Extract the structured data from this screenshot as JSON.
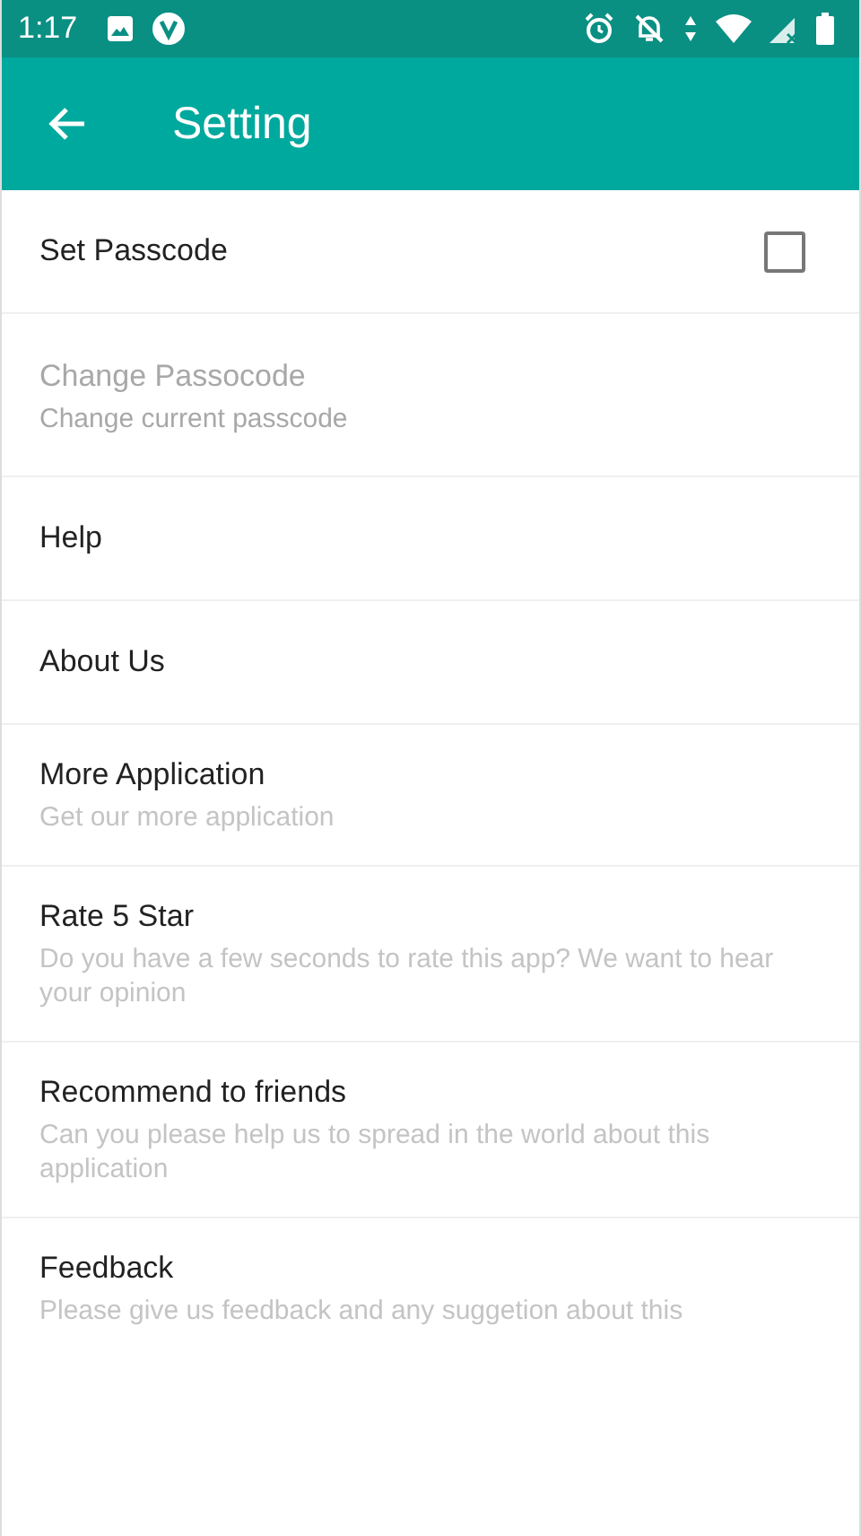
{
  "status_bar": {
    "time": "1:17"
  },
  "app_bar": {
    "title": "Setting"
  },
  "items": [
    {
      "kind": "checkbox",
      "title": "Set Passcode",
      "checked": false,
      "disabled": false
    },
    {
      "kind": "text",
      "title": "Change Passocode",
      "subtitle": "Change current passcode",
      "disabled": true
    },
    {
      "kind": "text",
      "title": "Help",
      "disabled": false
    },
    {
      "kind": "text",
      "title": "About Us",
      "disabled": false
    },
    {
      "kind": "text",
      "title": "More Application",
      "subtitle": "Get our more application",
      "disabled": false
    },
    {
      "kind": "text",
      "title": "Rate 5 Star",
      "subtitle": "Do you have a few seconds to rate this app? We want to hear your opinion",
      "disabled": false
    },
    {
      "kind": "text",
      "title": "Recommend to friends",
      "subtitle": "Can you please help us to spread in the world about this application",
      "disabled": false
    },
    {
      "kind": "text",
      "title": "Feedback",
      "subtitle": "Please give us feedback and any suggetion about this",
      "disabled": false
    }
  ]
}
